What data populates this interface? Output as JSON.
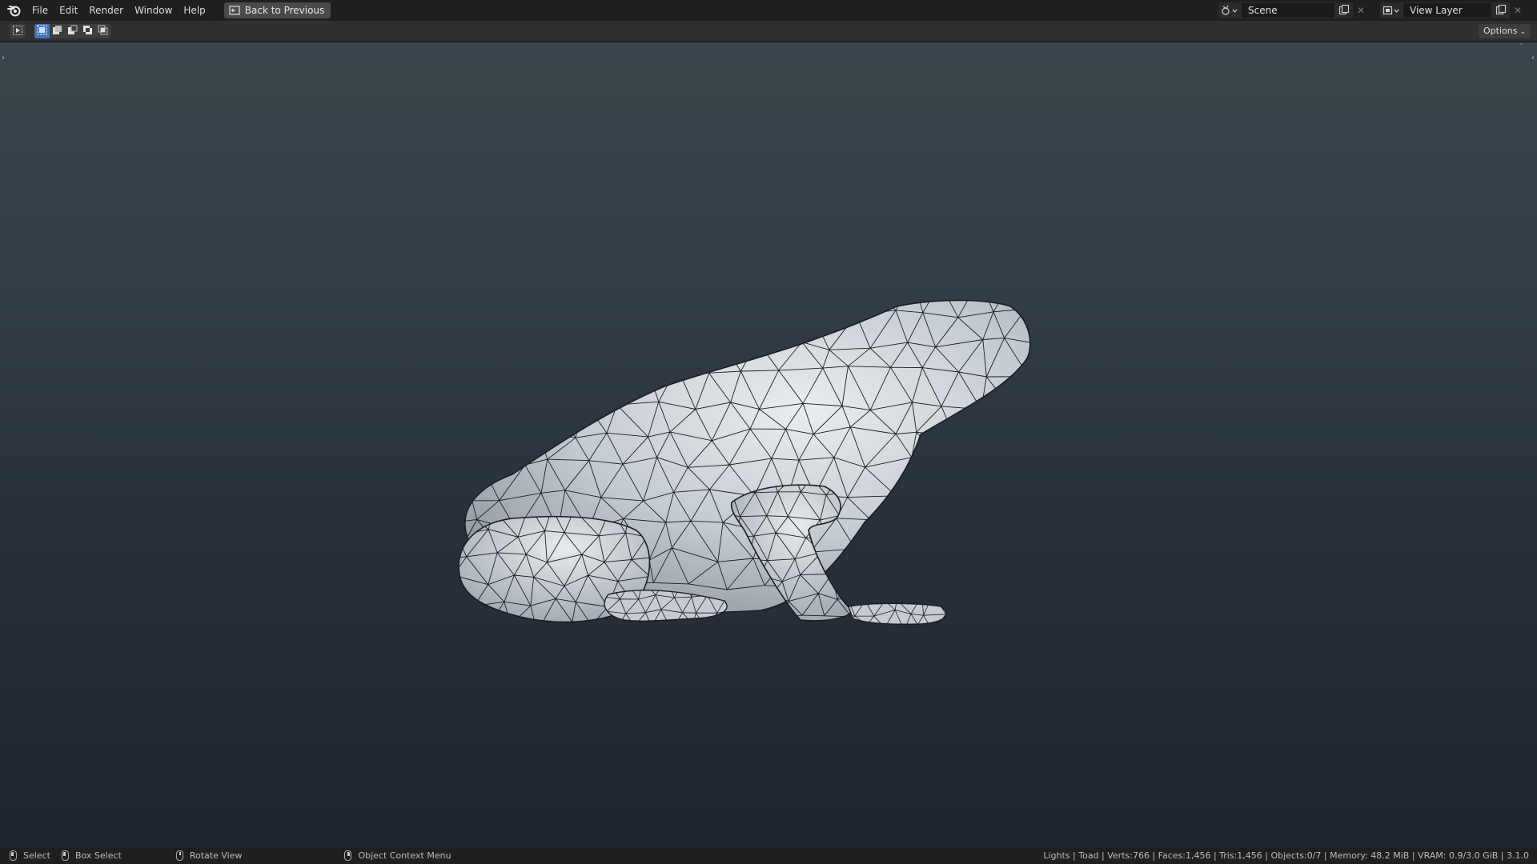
{
  "menubar": {
    "items": [
      "File",
      "Edit",
      "Render",
      "Window",
      "Help"
    ],
    "back_button": "Back to Previous"
  },
  "scene": {
    "value": "Scene"
  },
  "view_layer": {
    "value": "View Layer"
  },
  "header": {
    "options_label": "Options"
  },
  "status": {
    "select": "Select",
    "box_select": "Box Select",
    "rotate_view": "Rotate View",
    "context_menu": "Object Context Menu",
    "stats": "Lights | Toad | Verts:766 | Faces:1,456 | Tris:1,456 | Objects:0/7 | Memory: 48.2 MiB | VRAM: 0.9/3.0 GiB | 3.1.0"
  },
  "colors": {
    "accent": "#4772b3",
    "topbar": "#1f1f1f",
    "mesh_fill": "#c9cfd4",
    "wire": "#1a1e22"
  },
  "icons": [
    "blender-logo-icon",
    "back-icon",
    "scene-selector-icon",
    "view-layer-icon",
    "new-copy-icon",
    "close-icon",
    "tweak-tool-icon",
    "select-mode-icon",
    "mouse-icon"
  ]
}
